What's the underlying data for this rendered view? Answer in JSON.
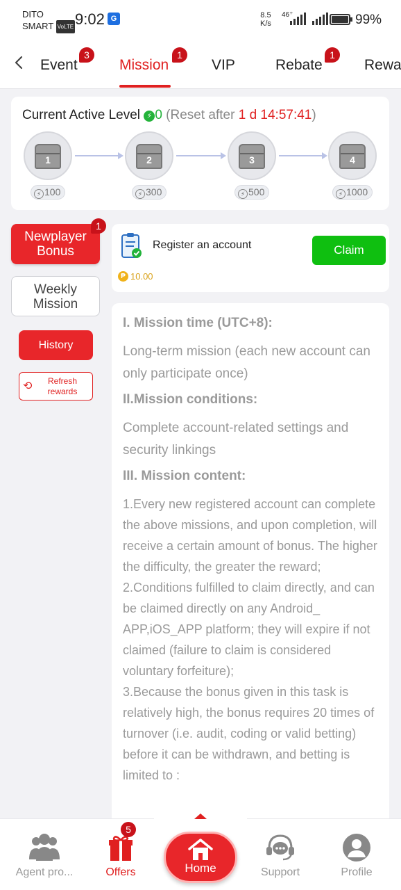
{
  "status_bar": {
    "carrier_line1": "DITO",
    "carrier_line2": "SMART",
    "volte": "VoLTE",
    "time": "9:02",
    "net_speed_value": "8.5",
    "net_speed_unit": "K/s",
    "network_type": "46⁺",
    "battery_percent": "99%"
  },
  "tabs": [
    {
      "label": "Event",
      "badge": "3"
    },
    {
      "label": "Mission",
      "badge": "1",
      "active": true
    },
    {
      "label": "VIP"
    },
    {
      "label": "Rebate",
      "badge": "1"
    },
    {
      "label": "Rewa"
    }
  ],
  "level": {
    "title": "Current Active Level",
    "active_value": "0",
    "reset_prefix": "(Reset after ",
    "reset_time": "1 d 14:57:41",
    "reset_suffix": ")",
    "chests": [
      {
        "number": "1",
        "points": "100"
      },
      {
        "number": "2",
        "points": "300"
      },
      {
        "number": "3",
        "points": "500"
      },
      {
        "number": "4",
        "points": "1000"
      }
    ]
  },
  "side_menu": {
    "newplayer_line1": "Newplayer",
    "newplayer_line2": "Bonus",
    "newplayer_badge": "1",
    "weekly_line1": "Weekly",
    "weekly_line2": "Mission",
    "history": "History",
    "refresh_line1": "Refresh",
    "refresh_line2": "rewards"
  },
  "task": {
    "title": "Register an account",
    "claim_label": "Claim",
    "reward": "10.00"
  },
  "rules": {
    "h1": "I. Mission time (UTC+8):",
    "p1": "Long-term mission (each new account can only participate once)",
    "h2": "II.Mission conditions:",
    "p2": "Complete account-related settings and security linkings",
    "h3": "III. Mission content:",
    "p3_1": "1.Every new registered account can complete the above missions, and upon completion, will receive a certain amount of bonus. The higher the difficulty, the greater the reward;",
    "p3_2": "2.Conditions fulfilled to claim directly, and can be claimed directly on any Android_ APP,iOS_APP platform; they will expire if not claimed (failure to claim is considered voluntary forfeiture);",
    "p3_3": "3.Because the bonus given in this task is relatively high, the bonus requires 20 times of turnover (i.e. audit, coding or valid betting) before it can be withdrawn, and betting is limited to :"
  },
  "bottom_nav": {
    "agent": "Agent pro...",
    "offers": "Offers",
    "offers_badge": "5",
    "home": "Home",
    "support": "Support",
    "profile": "Profile"
  },
  "colors": {
    "accent_red": "#e02020",
    "claim_green": "#0fbf10",
    "level_green": "#23b33a"
  }
}
